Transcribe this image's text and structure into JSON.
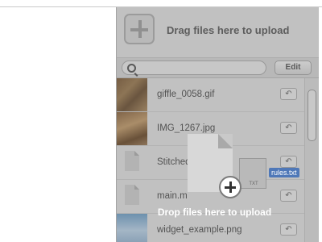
{
  "upload": {
    "drag_label": "Drag files here to upload"
  },
  "toolbar": {
    "edit_label": "Edit",
    "search_icon": "magnifier"
  },
  "files": [
    {
      "name": "giffle_0058.gif",
      "icon": "image-thumbnail"
    },
    {
      "name": "IMG_1267.jpg",
      "icon": "image-thumbnail"
    },
    {
      "name": "Stitched-Info.plist",
      "icon": "document"
    },
    {
      "name": "main.m",
      "icon": "document"
    },
    {
      "name": "widget_example.png",
      "icon": "image-thumbnail"
    }
  ],
  "row_action_icon": "share-arrow",
  "drop": {
    "message": "Drop files here to upload",
    "dragged_file": "rules.txt",
    "dragged_badge": "TXT"
  }
}
